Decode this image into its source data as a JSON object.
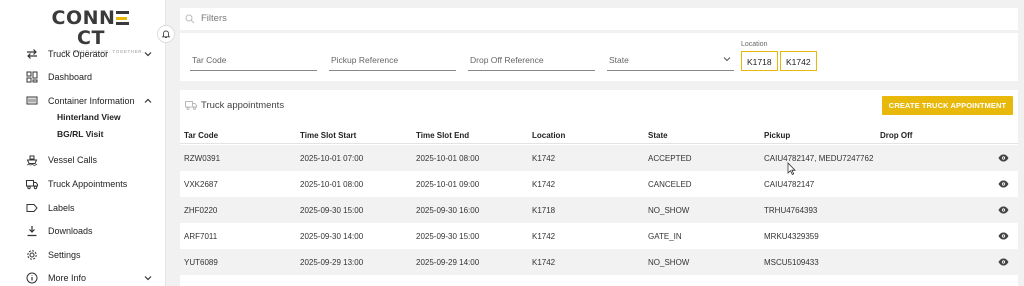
{
  "logo": {
    "word_left": "CONN",
    "word_right": "CT",
    "tagline": "WE BUILD VALUE. TOGETHER."
  },
  "sidebar": {
    "items": [
      {
        "label": "Truck Operator",
        "icon": "swap-arrows-icon",
        "chevron": "down"
      },
      {
        "label": "Dashboard",
        "icon": "dashboard-grid-icon"
      },
      {
        "label": "Container Information",
        "icon": "container-icon",
        "chevron": "up"
      },
      {
        "label": "Vessel Calls",
        "icon": "ship-icon"
      },
      {
        "label": "Truck Appointments",
        "icon": "truck-icon"
      },
      {
        "label": "Labels",
        "icon": "label-icon"
      },
      {
        "label": "Downloads",
        "icon": "download-icon"
      },
      {
        "label": "Settings",
        "icon": "gear-icon"
      },
      {
        "label": "More Info",
        "icon": "info-icon",
        "chevron": "down"
      }
    ],
    "subitems": [
      {
        "label": "Hinterland View"
      },
      {
        "label": "BG/RL Visit"
      }
    ]
  },
  "filters": {
    "title": "Filters",
    "tar_code": "Tar Code",
    "pickup_reference": "Pickup Reference",
    "dropoff_reference": "Drop Off Reference",
    "state": "State",
    "location_label": "Location",
    "locations": [
      "K1718",
      "K1742"
    ]
  },
  "appointments": {
    "title": "Truck appointments",
    "create_button": "CREATE TRUCK APPOINTMENT",
    "columns": [
      "Tar Code",
      "Time Slot Start",
      "Time Slot End",
      "Location",
      "State",
      "Pickup",
      "Drop Off"
    ],
    "rows": [
      [
        "RZW0391",
        "2025-10-01 07:00",
        "2025-10-01 08:00",
        "K1742",
        "ACCEPTED",
        "CAIU4782147, MEDU7247762",
        ""
      ],
      [
        "VXK2687",
        "2025-10-01 08:00",
        "2025-10-01 09:00",
        "K1742",
        "CANCELED",
        "CAIU4782147",
        ""
      ],
      [
        "ZHF0220",
        "2025-09-30 15:00",
        "2025-09-30 16:00",
        "K1718",
        "NO_SHOW",
        "TRHU4764393",
        ""
      ],
      [
        "ARF7011",
        "2025-09-30 14:00",
        "2025-09-30 15:00",
        "K1742",
        "GATE_IN",
        "MRKU4329359",
        ""
      ],
      [
        "YUT6089",
        "2025-09-29 13:00",
        "2025-09-29 14:00",
        "K1742",
        "NO_SHOW",
        "MSCU5109433",
        ""
      ]
    ]
  },
  "colors": {
    "accent": "#e8b90a",
    "logo_text": "#3a3a3a",
    "row_alt": "#f2f2f2"
  }
}
